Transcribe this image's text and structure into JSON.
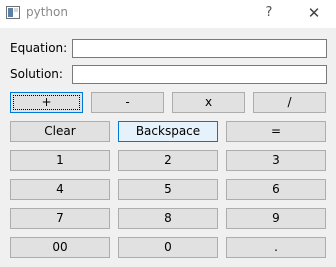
{
  "window": {
    "title": "python",
    "help_glyph": "?",
    "close_glyph": "✕"
  },
  "form": {
    "equation_label": "Equation:",
    "equation_value": "",
    "solution_label": "Solution:",
    "solution_value": ""
  },
  "operators": {
    "add": "+",
    "subtract": "-",
    "multiply": "x",
    "divide": "/"
  },
  "controls": {
    "clear": "Clear",
    "backspace": "Backspace",
    "equals": "="
  },
  "digits": {
    "one": "1",
    "two": "2",
    "three": "3",
    "four": "4",
    "five": "5",
    "six": "6",
    "seven": "7",
    "eight": "8",
    "nine": "9",
    "double_zero": "00",
    "zero": "0",
    "dot": "."
  }
}
